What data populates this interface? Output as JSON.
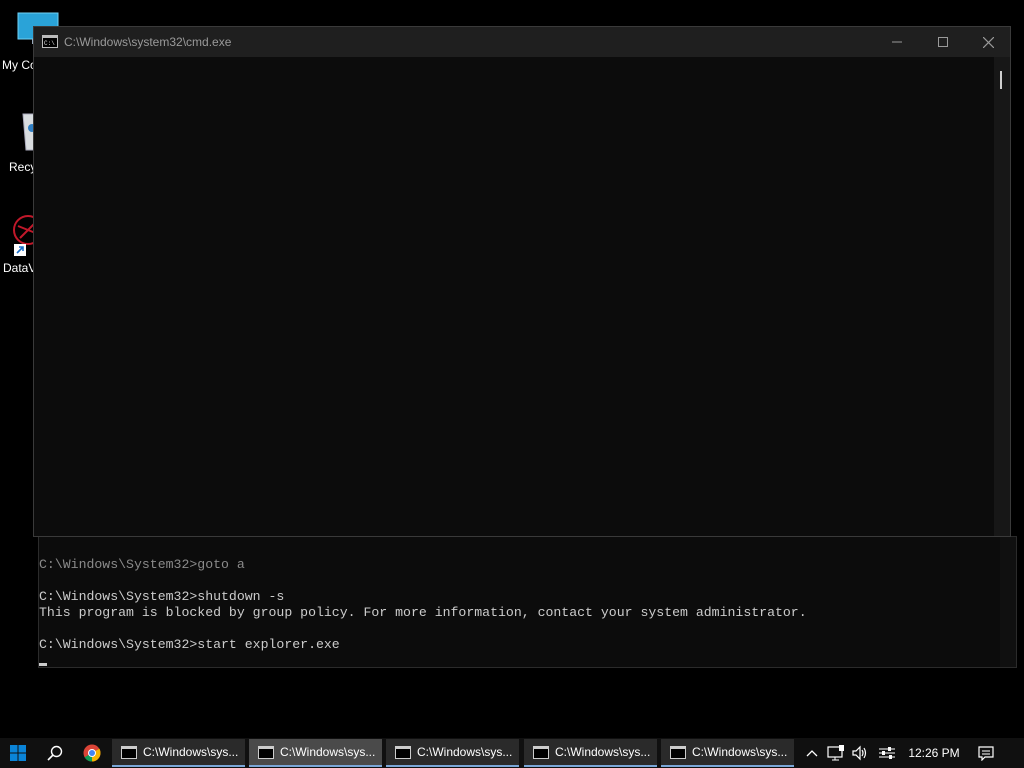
{
  "desktop": {
    "icons": [
      {
        "label": "My Co"
      },
      {
        "label": "Recy"
      },
      {
        "label": "DataV"
      }
    ]
  },
  "window": {
    "title": "C:\\Windows\\system32\\cmd.exe",
    "minimize_icon": "minimize-icon",
    "maximize_icon": "maximize-icon",
    "close_icon": "close-icon"
  },
  "console": {
    "lines": [
      "C:\\Windows\\System32>goto a",
      "",
      "C:\\Windows\\System32>shutdown -s",
      "This program is blocked by group policy. For more information, contact your system administrator.",
      "",
      "C:\\Windows\\System32>start explorer.exe"
    ]
  },
  "taskbar": {
    "tasks": [
      {
        "label": "C:\\Windows\\sys..."
      },
      {
        "label": "C:\\Windows\\sys..."
      },
      {
        "label": "C:\\Windows\\sys..."
      },
      {
        "label": "C:\\Windows\\sys..."
      },
      {
        "label": "C:\\Windows\\sys..."
      }
    ],
    "clock": "12:26 PM"
  }
}
